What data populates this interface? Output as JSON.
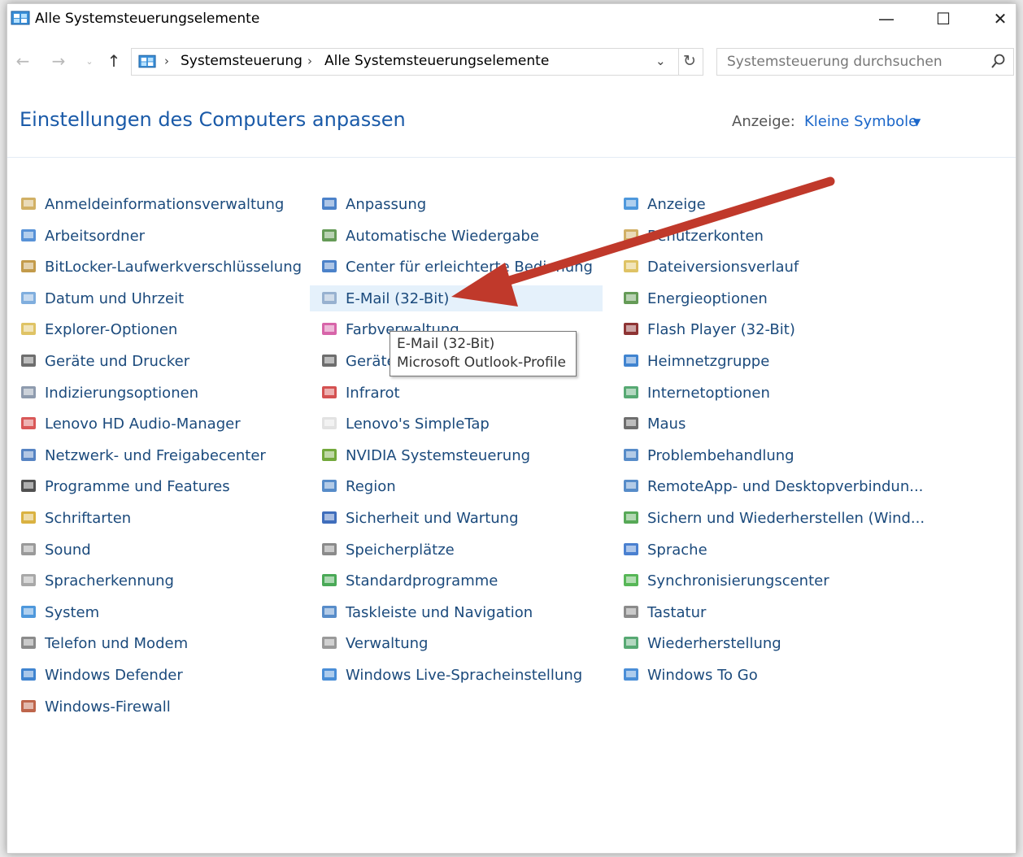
{
  "window": {
    "title": "Alle Systemsteuerungselemente",
    "controls": {
      "minimize": "—",
      "maximize": "☐",
      "close": "✕"
    }
  },
  "address": {
    "breadcrumb": [
      "Systemsteuerung",
      "Alle Systemsteuerungselemente"
    ],
    "separator": "›"
  },
  "search": {
    "placeholder": "Systemsteuerung durchsuchen"
  },
  "header": {
    "title": "Einstellungen des Computers anpassen",
    "view_label": "Anzeige:",
    "view_value": "Kleine Symbole"
  },
  "columns": [
    [
      {
        "label": "Anmeldeinformationsverwaltung",
        "icon": "credential-vault-icon"
      },
      {
        "label": "Arbeitsordner",
        "icon": "work-folders-icon"
      },
      {
        "label": "BitLocker-Laufwerkverschlüsselung",
        "icon": "bitlocker-icon"
      },
      {
        "label": "Datum und Uhrzeit",
        "icon": "date-time-icon"
      },
      {
        "label": "Explorer-Optionen",
        "icon": "explorer-options-icon"
      },
      {
        "label": "Geräte und Drucker",
        "icon": "printer-icon"
      },
      {
        "label": "Indizierungsoptionen",
        "icon": "indexing-icon"
      },
      {
        "label": "Lenovo HD Audio-Manager",
        "icon": "lenovo-audio-icon"
      },
      {
        "label": "Netzwerk- und Freigabecenter",
        "icon": "network-icon"
      },
      {
        "label": "Programme und Features",
        "icon": "programs-icon"
      },
      {
        "label": "Schriftarten",
        "icon": "fonts-icon"
      },
      {
        "label": "Sound",
        "icon": "sound-icon"
      },
      {
        "label": "Spracherkennung",
        "icon": "microphone-icon"
      },
      {
        "label": "System",
        "icon": "system-icon"
      },
      {
        "label": "Telefon und Modem",
        "icon": "phone-modem-icon"
      },
      {
        "label": "Windows Defender",
        "icon": "defender-icon"
      },
      {
        "label": "Windows-Firewall",
        "icon": "firewall-icon"
      }
    ],
    [
      {
        "label": "Anpassung",
        "icon": "personalization-icon"
      },
      {
        "label": "Automatische Wiedergabe",
        "icon": "autoplay-icon"
      },
      {
        "label": "Center für erleichterte Bedienung",
        "icon": "ease-of-access-icon"
      },
      {
        "label": "E-Mail (32-Bit)",
        "icon": "mail-icon"
      },
      {
        "label": "Farbverwaltung",
        "icon": "color-management-icon"
      },
      {
        "label": "Geräte-Manager",
        "icon": "device-manager-icon"
      },
      {
        "label": "Infrarot",
        "icon": "infrared-icon"
      },
      {
        "label": "Lenovo's SimpleTap",
        "icon": "document-icon"
      },
      {
        "label": "NVIDIA Systemsteuerung",
        "icon": "nvidia-icon"
      },
      {
        "label": "Region",
        "icon": "region-icon"
      },
      {
        "label": "Sicherheit und Wartung",
        "icon": "flag-icon"
      },
      {
        "label": "Speicherplätze",
        "icon": "storage-icon"
      },
      {
        "label": "Standardprogramme",
        "icon": "default-programs-icon"
      },
      {
        "label": "Taskleiste und Navigation",
        "icon": "taskbar-icon"
      },
      {
        "label": "Verwaltung",
        "icon": "admin-tools-icon"
      },
      {
        "label": "Windows Live-Spracheinstellung",
        "icon": "globe-icon"
      }
    ],
    [
      {
        "label": "Anzeige",
        "icon": "display-icon"
      },
      {
        "label": "Benutzerkonten",
        "icon": "user-accounts-icon"
      },
      {
        "label": "Dateiversionsverlauf",
        "icon": "file-history-icon"
      },
      {
        "label": "Energieoptionen",
        "icon": "power-icon"
      },
      {
        "label": "Flash Player (32-Bit)",
        "icon": "flash-icon"
      },
      {
        "label": "Heimnetzgruppe",
        "icon": "homegroup-icon"
      },
      {
        "label": "Internetoptionen",
        "icon": "internet-options-icon"
      },
      {
        "label": "Maus",
        "icon": "mouse-icon"
      },
      {
        "label": "Problembehandlung",
        "icon": "troubleshooting-icon"
      },
      {
        "label": "RemoteApp- und Desktopverbindun...",
        "icon": "remoteapp-icon"
      },
      {
        "label": "Sichern und Wiederherstellen (Wind...",
        "icon": "backup-icon"
      },
      {
        "label": "Sprache",
        "icon": "language-icon"
      },
      {
        "label": "Synchronisierungscenter",
        "icon": "sync-icon"
      },
      {
        "label": "Tastatur",
        "icon": "keyboard-icon"
      },
      {
        "label": "Wiederherstellung",
        "icon": "recovery-icon"
      },
      {
        "label": "Windows To Go",
        "icon": "windows-to-go-icon"
      }
    ]
  ],
  "tooltip": {
    "title": "E-Mail (32-Bit)",
    "text": "Microsoft Outlook-Profile"
  },
  "colors": {
    "link": "#1b4a7c",
    "title": "#1a5aa8",
    "highlight": "#e5f1fb",
    "arrow": "#c0392b"
  }
}
